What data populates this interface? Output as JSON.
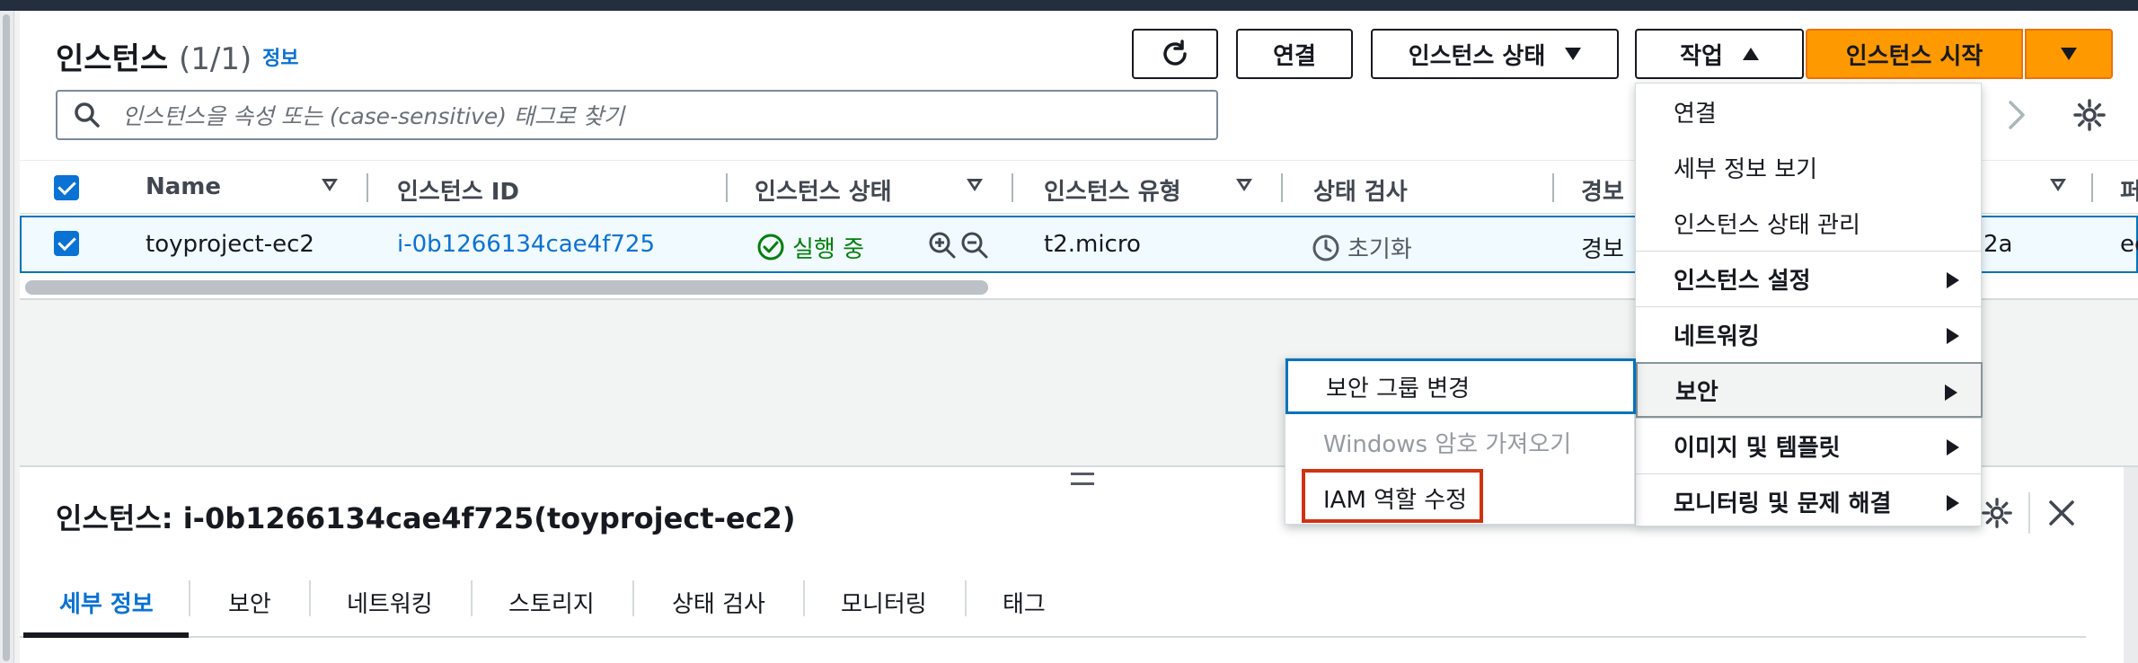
{
  "header": {
    "title": "인스턴스",
    "count": "(1/1)",
    "info_link": "정보"
  },
  "toolbar": {
    "refresh_icon": "refresh-icon",
    "connect_label": "연결",
    "instance_state_label": "인스턴스 상태",
    "actions_label": "작업",
    "launch_label": "인스턴스 시작"
  },
  "search": {
    "placeholder": "인스턴스을 속성 또는 (case-sensitive) 태그로 찾기"
  },
  "table": {
    "columns": [
      "Name",
      "인스턴스 ID",
      "인스턴스 상태",
      "인스턴스 유형",
      "상태 검사",
      "경보 ",
      "",
      "퍼"
    ],
    "rows": [
      {
        "name": "toyproject-ec2",
        "instance_id": "i-0b1266134cae4f725",
        "state": "실행 중",
        "type": "t2.micro",
        "status_check": "초기화",
        "alarm": "경보 ",
        "az": "2a",
        "public": "ec"
      }
    ]
  },
  "actions_menu": {
    "items": [
      {
        "label": "연결",
        "submenu": false
      },
      {
        "label": "세부 정보 보기",
        "submenu": false
      },
      {
        "label": "인스턴스 상태 관리",
        "submenu": false
      },
      {
        "label": "인스턴스 설정",
        "submenu": true
      },
      {
        "label": "네트워킹",
        "submenu": true
      },
      {
        "label": "보안",
        "submenu": true,
        "selected": true
      },
      {
        "label": "이미지 및 템플릿",
        "submenu": true
      },
      {
        "label": "모니터링 및 문제 해결",
        "submenu": true
      }
    ]
  },
  "security_submenu": {
    "items": [
      {
        "label": "보안 그룹 변경",
        "state": "focused"
      },
      {
        "label": "Windows 암호 가져오기",
        "state": "disabled"
      },
      {
        "label": "IAM 역할 수정",
        "state": "highlighted"
      }
    ]
  },
  "details": {
    "title": "인스턴스: i-0b1266134cae4f725(toyproject-ec2)",
    "tabs": [
      "세부 정보",
      "보안",
      "네트워킹",
      "스토리지",
      "상태 검사",
      "모니터링",
      "태그"
    ],
    "active_tab": "세부 정보"
  },
  "colors": {
    "accent_blue": "#0972d3",
    "primary_orange": "#ff9900",
    "success_green": "#037f0c",
    "highlight_red": "#d13212"
  }
}
